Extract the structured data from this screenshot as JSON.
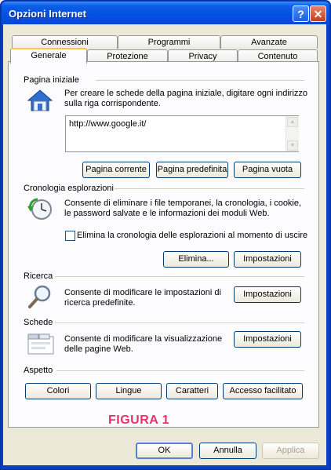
{
  "window": {
    "title": "Opzioni Internet"
  },
  "titlebar_buttons": {
    "help": "?",
    "close": "✕"
  },
  "tabs": {
    "row_back": [
      "Connessioni",
      "Programmi",
      "Avanzate"
    ],
    "row_front": [
      "Generale",
      "Protezione",
      "Privacy",
      "Contenuto"
    ],
    "active": "Generale"
  },
  "home_page": {
    "heading": "Pagina iniziale",
    "description": "Per creare le schede della pagina iniziale, digitare ogni indirizzo sulla riga corrispondente.",
    "url_value": "http://www.google.it/",
    "buttons": {
      "current": "Pagina corrente",
      "default": "Pagina predefinita",
      "blank": "Pagina vuota"
    }
  },
  "history": {
    "heading": "Cronologia esplorazioni",
    "description": "Consente di eliminare i file temporanei, la cronologia, i cookie, le password salvate e le informazioni dei moduli Web.",
    "checkbox_label": "Elimina la cronologia delle esplorazioni al momento di uscire",
    "checkbox_checked": false,
    "buttons": {
      "delete": "Elimina...",
      "settings": "Impostazioni"
    }
  },
  "search": {
    "heading": "Ricerca",
    "description": "Consente di modificare le impostazioni di ricerca predefinite.",
    "settings": "Impostazioni"
  },
  "tabs_section": {
    "heading": "Schede",
    "description": "Consente di modificare la visualizzazione delle pagine Web.",
    "settings": "Impostazioni"
  },
  "appearance": {
    "heading": "Aspetto",
    "buttons": {
      "colors": "Colori",
      "languages": "Lingue",
      "fonts": "Caratteri",
      "accessibility": "Accesso facilitato"
    }
  },
  "annotation": "FIGURA 1",
  "footer": {
    "ok": "OK",
    "cancel": "Annulla",
    "apply": "Applica"
  },
  "colors": {
    "titlebar": "#0450e0",
    "dialog": "#ece9d8",
    "annotation": "#e8336a",
    "tab_highlight": "#ffc83c"
  }
}
